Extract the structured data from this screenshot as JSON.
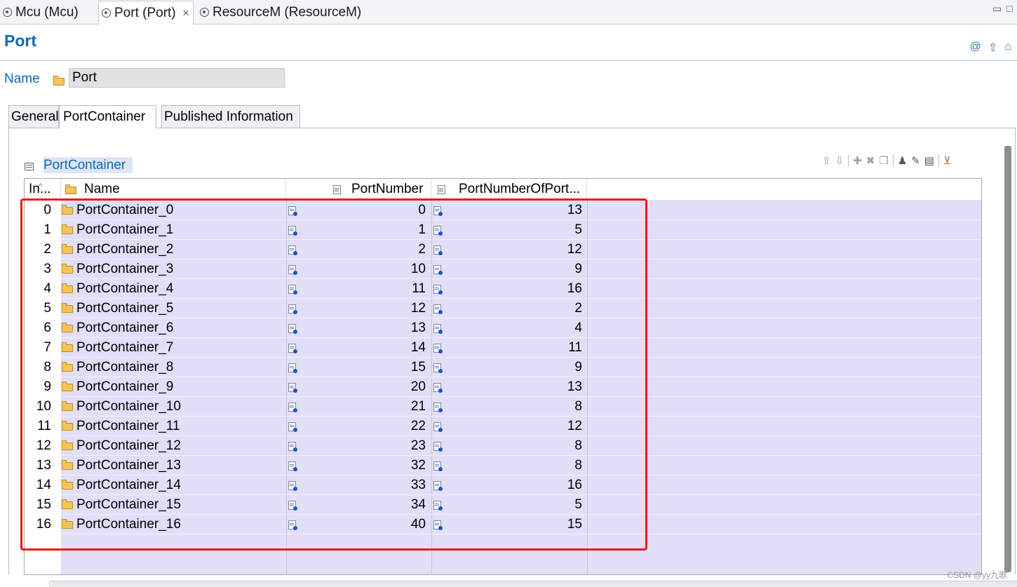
{
  "editor_tabs": [
    {
      "label": "Mcu (Mcu)",
      "active": false
    },
    {
      "label": "Port (Port)",
      "active": true
    },
    {
      "label": "ResourceM (ResourceM)",
      "active": false
    }
  ],
  "window_controls": {
    "minimize": "▭",
    "maximize": "□"
  },
  "page": {
    "title": "Port"
  },
  "name_field": {
    "label": "Name",
    "value": "Port"
  },
  "property_tabs": [
    {
      "label": "General",
      "active": false
    },
    {
      "label": "PortContainer",
      "active": true
    },
    {
      "label": "Published Information",
      "active": false
    }
  ],
  "section": {
    "title": "PortContainer"
  },
  "table": {
    "columns": [
      {
        "label": "In..."
      },
      {
        "label": "Name"
      },
      {
        "label": "PortNumber"
      },
      {
        "label": "PortNumberOfPort..."
      }
    ],
    "rows": [
      {
        "index": "0",
        "name": "PortContainer_0",
        "port_number": "0",
        "port_number_of_port": "13"
      },
      {
        "index": "1",
        "name": "PortContainer_1",
        "port_number": "1",
        "port_number_of_port": "5"
      },
      {
        "index": "2",
        "name": "PortContainer_2",
        "port_number": "2",
        "port_number_of_port": "12"
      },
      {
        "index": "3",
        "name": "PortContainer_3",
        "port_number": "10",
        "port_number_of_port": "9"
      },
      {
        "index": "4",
        "name": "PortContainer_4",
        "port_number": "11",
        "port_number_of_port": "16"
      },
      {
        "index": "5",
        "name": "PortContainer_5",
        "port_number": "12",
        "port_number_of_port": "2"
      },
      {
        "index": "6",
        "name": "PortContainer_6",
        "port_number": "13",
        "port_number_of_port": "4"
      },
      {
        "index": "7",
        "name": "PortContainer_7",
        "port_number": "14",
        "port_number_of_port": "11"
      },
      {
        "index": "8",
        "name": "PortContainer_8",
        "port_number": "15",
        "port_number_of_port": "9"
      },
      {
        "index": "9",
        "name": "PortContainer_9",
        "port_number": "20",
        "port_number_of_port": "13"
      },
      {
        "index": "10",
        "name": "PortContainer_10",
        "port_number": "21",
        "port_number_of_port": "8"
      },
      {
        "index": "11",
        "name": "PortContainer_11",
        "port_number": "22",
        "port_number_of_port": "12"
      },
      {
        "index": "12",
        "name": "PortContainer_12",
        "port_number": "23",
        "port_number_of_port": "8"
      },
      {
        "index": "13",
        "name": "PortContainer_13",
        "port_number": "32",
        "port_number_of_port": "8"
      },
      {
        "index": "14",
        "name": "PortContainer_14",
        "port_number": "33",
        "port_number_of_port": "16"
      },
      {
        "index": "15",
        "name": "PortContainer_15",
        "port_number": "34",
        "port_number_of_port": "5"
      },
      {
        "index": "16",
        "name": "PortContainer_16",
        "port_number": "40",
        "port_number_of_port": "15"
      }
    ]
  },
  "watermark": "CSDN @yy九歌",
  "colors": {
    "accent": "#1066b5",
    "row_bg": "#e3def8",
    "highlight": "#f01818"
  }
}
